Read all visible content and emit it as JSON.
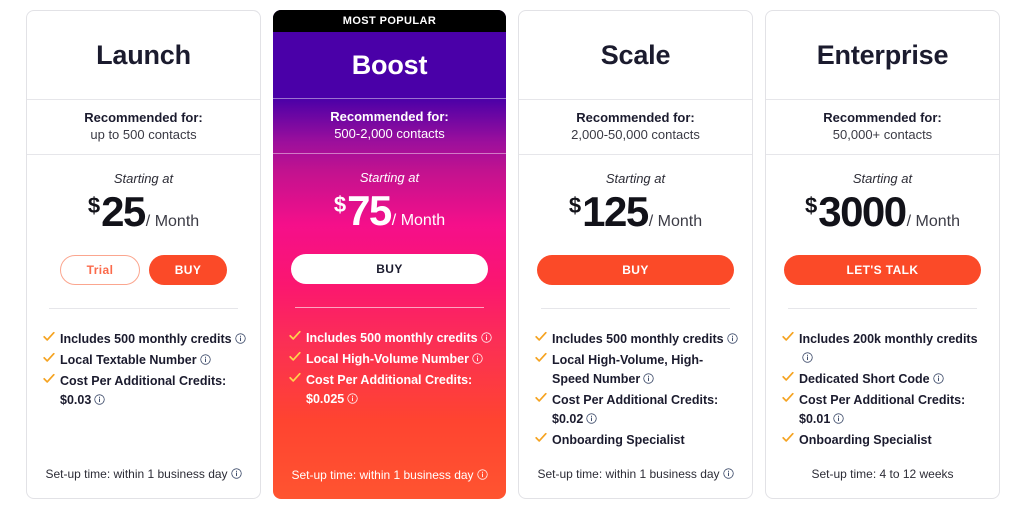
{
  "plans": [
    {
      "name": "Launch",
      "featured": false,
      "badge": null,
      "recommended_label": "Recommended for:",
      "recommended_value": "up to 500 contacts",
      "starting_at": "Starting at",
      "currency": "$",
      "amount": "25",
      "period": "/ Month",
      "buttons": [
        {
          "label": "Trial",
          "style": "outline",
          "name": "trial-button"
        },
        {
          "label": "BUY",
          "style": "primary",
          "name": "buy-button"
        }
      ],
      "features": [
        {
          "text": "Includes 500 monthly credits",
          "info": true
        },
        {
          "text": "Local Textable Number",
          "info": true
        },
        {
          "text": "Cost Per Additional Credits: $0.03",
          "info": true
        }
      ],
      "setup_note": "Set-up time: within 1 business day",
      "setup_info": true
    },
    {
      "name": "Boost",
      "featured": true,
      "badge": "MOST POPULAR",
      "recommended_label": "Recommended for:",
      "recommended_value": "500-2,000 contacts",
      "starting_at": "Starting at",
      "currency": "$",
      "amount": "75",
      "period": "/ Month",
      "buttons": [
        {
          "label": "BUY",
          "style": "white",
          "name": "buy-button"
        }
      ],
      "features": [
        {
          "text": "Includes 500 monthly credits",
          "info": true
        },
        {
          "text": "Local High-Volume Number",
          "info": true
        },
        {
          "text": "Cost Per Additional Credits: $0.025",
          "info": true
        }
      ],
      "setup_note": "Set-up time: within 1 business day",
      "setup_info": true
    },
    {
      "name": "Scale",
      "featured": false,
      "badge": null,
      "recommended_label": "Recommended for:",
      "recommended_value": "2,000-50,000 contacts",
      "starting_at": "Starting at",
      "currency": "$",
      "amount": "125",
      "period": "/ Month",
      "buttons": [
        {
          "label": "BUY",
          "style": "wide",
          "name": "buy-button"
        }
      ],
      "features": [
        {
          "text": "Includes 500 monthly credits",
          "info": true
        },
        {
          "text": "Local High-Volume, High-Speed Number",
          "info": true
        },
        {
          "text": "Cost Per Additional Credits: $0.02",
          "info": true
        },
        {
          "text": "Onboarding Specialist",
          "info": false
        }
      ],
      "setup_note": "Set-up time: within 1 business day",
      "setup_info": true
    },
    {
      "name": "Enterprise",
      "featured": false,
      "badge": null,
      "recommended_label": "Recommended for:",
      "recommended_value": "50,000+ contacts",
      "starting_at": "Starting at",
      "currency": "$",
      "amount": "3000",
      "period": "/ Month",
      "buttons": [
        {
          "label": "LET'S TALK",
          "style": "wide",
          "name": "lets-talk-button"
        }
      ],
      "features": [
        {
          "text": "Includes 200k monthly credits",
          "info": true
        },
        {
          "text": "Dedicated Short Code",
          "info": true
        },
        {
          "text": "Cost Per Additional Credits: $0.01",
          "info": true
        },
        {
          "text": "Onboarding Specialist",
          "info": false
        }
      ],
      "setup_note": "Set-up time: 4 to 12 weeks",
      "setup_info": false
    }
  ],
  "colors": {
    "accent_orange": "#fb4a28",
    "check_amber": "#f5a321",
    "info_navy": "#2b3a5c",
    "banner_black": "#000000",
    "featured_gradient_top": "#4a00a8",
    "featured_gradient_mid": "#f50f8a",
    "featured_gradient_bottom": "#ff5430",
    "card_border": "#e2e2e6",
    "text_dark": "#1b1b2e"
  }
}
